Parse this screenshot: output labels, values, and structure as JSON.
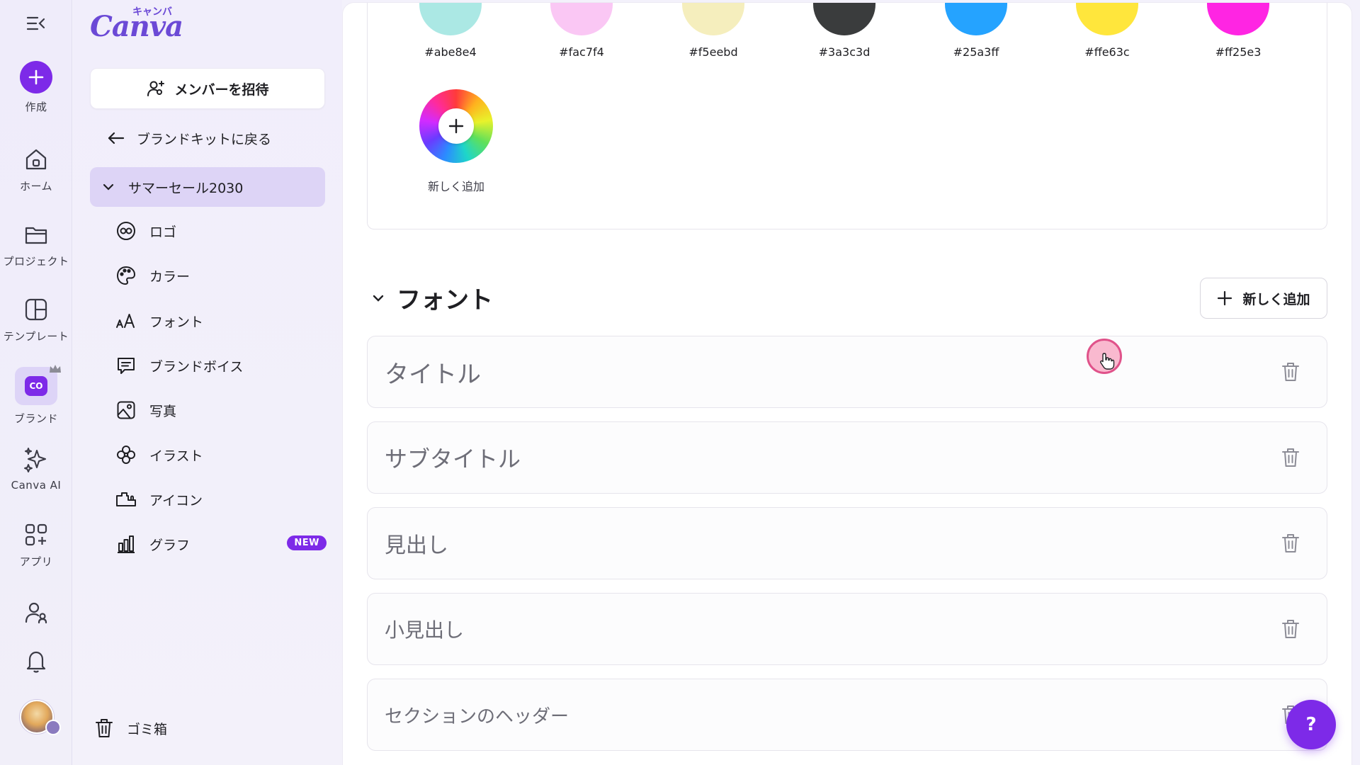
{
  "rail": {
    "items": [
      {
        "key": "create",
        "label": "作成",
        "icon": "plus-icon"
      },
      {
        "key": "home",
        "label": "ホーム",
        "icon": "home-icon"
      },
      {
        "key": "projects",
        "label": "プロジェクト",
        "icon": "folder-icon"
      },
      {
        "key": "templates",
        "label": "テンプレート",
        "icon": "template-icon"
      },
      {
        "key": "brand",
        "label": "ブランド",
        "icon": "brand-icon",
        "badge": "CO"
      },
      {
        "key": "canva_ai",
        "label": "Canva AI",
        "icon": "sparkle-icon"
      },
      {
        "key": "apps",
        "label": "アプリ",
        "icon": "apps-icon"
      }
    ]
  },
  "logo": {
    "word": "Canva",
    "kana": "キャンバ"
  },
  "sidebar": {
    "invite_label": "メンバーを招待",
    "back_label": "ブランドキットに戻る",
    "kit_name": "サマーセール2030",
    "nav": [
      {
        "label": "ロゴ",
        "icon": "logo-icon"
      },
      {
        "label": "カラー",
        "icon": "palette-icon"
      },
      {
        "label": "フォント",
        "icon": "font-icon"
      },
      {
        "label": "ブランドボイス",
        "icon": "brand-voice-icon"
      },
      {
        "label": "写真",
        "icon": "photo-icon"
      },
      {
        "label": "イラスト",
        "icon": "illustration-icon"
      },
      {
        "label": "アイコン",
        "icon": "icon-icon"
      },
      {
        "label": "グラフ",
        "icon": "chart-icon",
        "badge": "NEW"
      }
    ],
    "trash_label": "ゴミ箱"
  },
  "colors": {
    "swatches": [
      {
        "code": "#abe8e4",
        "color": "#abe8e4"
      },
      {
        "code": "#fac7f4",
        "color": "#fac7f4"
      },
      {
        "code": "#f5eebd",
        "color": "#f5eebd"
      },
      {
        "code": "#3a3c3d",
        "color": "#3a3c3d"
      },
      {
        "code": "#25a3ff",
        "color": "#25a3ff"
      },
      {
        "code": "#ffe63c",
        "color": "#ffe63c"
      },
      {
        "code": "#ff25e3",
        "color": "#ff25e3"
      }
    ],
    "add_label": "新しく追加"
  },
  "fonts": {
    "section_title": "フォント",
    "add_label": "新しく追加",
    "rows": [
      {
        "name": "タイトル"
      },
      {
        "name": "サブタイトル"
      },
      {
        "name": "見出し"
      },
      {
        "name": "小見出し"
      },
      {
        "name": "セクションのヘッダー"
      }
    ]
  },
  "help_label": "?",
  "accent_color": "#7d2ae8"
}
